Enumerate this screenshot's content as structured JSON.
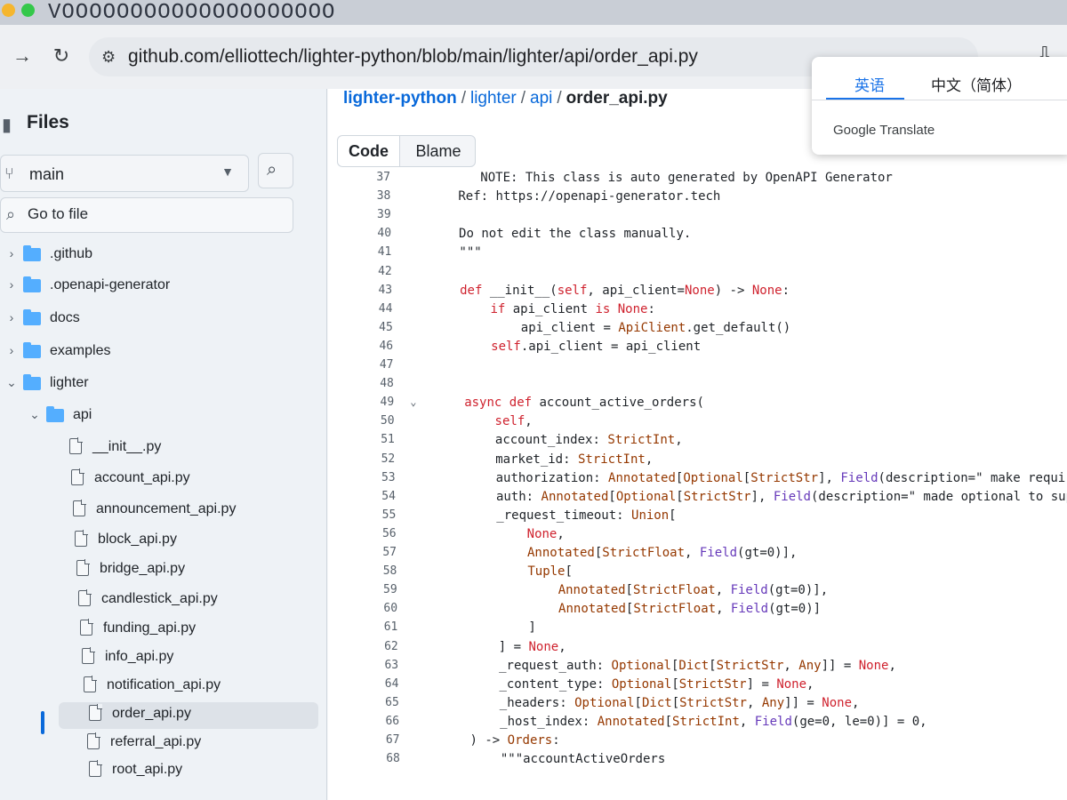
{
  "browser": {
    "tab_strip_text": "VOOOOOOOOOOOOOOOOOOOO",
    "url": "github.com/elliottech/lighter-python/blob/main/lighter/api/order_api.py",
    "icons": [
      "back-arrow-icon",
      "reload-icon",
      "site-settings-icon",
      "install-app-icon"
    ]
  },
  "translate_popup": {
    "tabs": [
      "英语",
      "中文（简体）"
    ],
    "active_tab": "英语",
    "brand": "Google Translate"
  },
  "sidebar": {
    "title": "Files",
    "branch": "main",
    "search_placeholder": "Go to file",
    "tree": [
      {
        "label": ".github",
        "type": "folder",
        "depth": 0,
        "expanded": false
      },
      {
        "label": ".openapi-generator",
        "type": "folder",
        "depth": 0,
        "expanded": false
      },
      {
        "label": "docs",
        "type": "folder",
        "depth": 0,
        "expanded": false
      },
      {
        "label": "examples",
        "type": "folder",
        "depth": 0,
        "expanded": false
      },
      {
        "label": "lighter",
        "type": "folder",
        "depth": 0,
        "expanded": true
      },
      {
        "label": "api",
        "type": "folder",
        "depth": 1,
        "expanded": true
      },
      {
        "label": "__init__.py",
        "type": "file",
        "depth": 2
      },
      {
        "label": "account_api.py",
        "type": "file",
        "depth": 2
      },
      {
        "label": "announcement_api.py",
        "type": "file",
        "depth": 2
      },
      {
        "label": "block_api.py",
        "type": "file",
        "depth": 2
      },
      {
        "label": "bridge_api.py",
        "type": "file",
        "depth": 2
      },
      {
        "label": "candlestick_api.py",
        "type": "file",
        "depth": 2
      },
      {
        "label": "funding_api.py",
        "type": "file",
        "depth": 2
      },
      {
        "label": "info_api.py",
        "type": "file",
        "depth": 2
      },
      {
        "label": "notification_api.py",
        "type": "file",
        "depth": 2
      },
      {
        "label": "order_api.py",
        "type": "file",
        "depth": 2,
        "selected": true
      },
      {
        "label": "referral_api.py",
        "type": "file",
        "depth": 2
      },
      {
        "label": "root_api.py",
        "type": "file",
        "depth": 2
      }
    ]
  },
  "breadcrumb": {
    "repo": "lighter-python",
    "parts": [
      "lighter",
      "api"
    ],
    "current": "order_api.py"
  },
  "view_tabs": {
    "code": "Code",
    "blame": "Blame",
    "active": "Code"
  },
  "code": {
    "lines": [
      {
        "n": 37,
        "indent": 0,
        "text": "   NOTE: This class is auto generated by OpenAPI Generator"
      },
      {
        "n": 38,
        "indent": 0,
        "text": "Ref: https://openapi-generator.tech"
      },
      {
        "n": 39,
        "indent": 0,
        "text": ""
      },
      {
        "n": 40,
        "indent": 0,
        "text": "Do not edit the class manually."
      },
      {
        "n": 41,
        "indent": 0,
        "text": "\"\"\""
      },
      {
        "n": 42,
        "indent": 0,
        "text": ""
      },
      {
        "n": 43,
        "indent": 0,
        "text": "def __init__(self, api_client=None) -> None:"
      },
      {
        "n": 44,
        "indent": 1,
        "text": "if api_client is None:"
      },
      {
        "n": 45,
        "indent": 2,
        "text": "api_client = ApiClient.get_default()"
      },
      {
        "n": 46,
        "indent": 1,
        "text": "self.api_client = api_client"
      },
      {
        "n": 47,
        "indent": 0,
        "text": ""
      },
      {
        "n": 48,
        "indent": 0,
        "text": ""
      },
      {
        "n": 49,
        "indent": 0,
        "text": "async def account_active_orders(",
        "fold": true
      },
      {
        "n": 50,
        "indent": 1,
        "text": "self,"
      },
      {
        "n": 51,
        "indent": 1,
        "text": "account_index: StrictInt,"
      },
      {
        "n": 52,
        "indent": 1,
        "text": "market_id: StrictInt,"
      },
      {
        "n": 53,
        "indent": 1,
        "text": "authorization: Annotated[Optional[StrictStr], Field(description=\" make requi"
      },
      {
        "n": 54,
        "indent": 1,
        "text": "auth: Annotated[Optional[StrictStr], Field(description=\" made optional to sup"
      },
      {
        "n": 55,
        "indent": 1,
        "text": "_request_timeout: Union["
      },
      {
        "n": 56,
        "indent": 2,
        "text": "None,"
      },
      {
        "n": 57,
        "indent": 2,
        "text": "Annotated[StrictFloat, Field(gt=0)],"
      },
      {
        "n": 58,
        "indent": 2,
        "text": "Tuple["
      },
      {
        "n": 59,
        "indent": 3,
        "text": "Annotated[StrictFloat, Field(gt=0)],"
      },
      {
        "n": 60,
        "indent": 3,
        "text": "Annotated[StrictFloat, Field(gt=0)]"
      },
      {
        "n": 61,
        "indent": 2,
        "text": "]"
      },
      {
        "n": 62,
        "indent": 1,
        "text": "] = None,"
      },
      {
        "n": 63,
        "indent": 1,
        "text": "_request_auth: Optional[Dict[StrictStr, Any]] = None,"
      },
      {
        "n": 64,
        "indent": 1,
        "text": "_content_type: Optional[StrictStr] = None,"
      },
      {
        "n": 65,
        "indent": 1,
        "text": "_headers: Optional[Dict[StrictStr, Any]] = None,"
      },
      {
        "n": 66,
        "indent": 1,
        "text": "_host_index: Annotated[StrictInt, Field(ge=0, le=0)] = 0,"
      },
      {
        "n": 67,
        "indent": 0,
        "text": ") -> Orders:"
      },
      {
        "n": 68,
        "indent": 1,
        "text": "\"\"\"accountActiveOrders"
      }
    ]
  }
}
